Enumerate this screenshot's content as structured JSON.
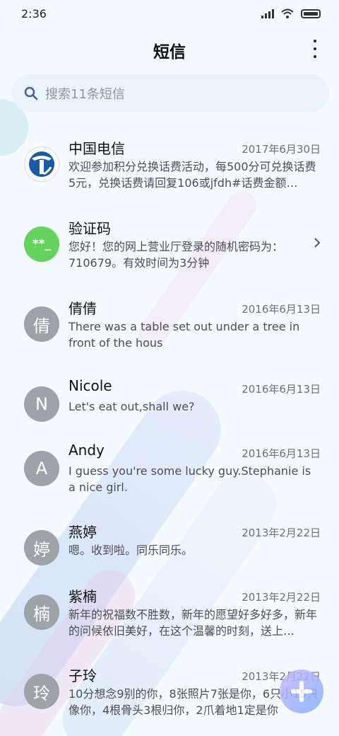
{
  "status_bar": {
    "time": "2:36"
  },
  "header": {
    "title": "短信"
  },
  "search": {
    "placeholder": "搜索11条短信"
  },
  "messages": [
    {
      "name": "中国电信",
      "date": "2017年6月30日",
      "preview": "欢迎参加积分兑换话费活动，每500分可兑换话费5元，兑换话费请回复106或jfdh#话费金额…",
      "avatar": "china-telecom-logo"
    },
    {
      "name": "验证码",
      "date": "",
      "preview": "您好！您的网上营业厅登录的随机密码为：710679。有效时间为3分钟",
      "avatar_text": "**_"
    },
    {
      "name": "倩倩",
      "date": "2016年6月13日",
      "preview": "There was a table set out under a tree in front of the hous",
      "avatar_text": "倩"
    },
    {
      "name": "Nicole",
      "date": "2016年6月13日",
      "preview": "Let's eat out,shall we?",
      "avatar_text": "N"
    },
    {
      "name": "Andy",
      "date": "2016年6月13日",
      "preview": "I guess you're some lucky guy.Stephanie is a nice girl.",
      "avatar_text": "A"
    },
    {
      "name": "燕婷",
      "date": "2013年2月22日",
      "preview": "嗯。收到啦。同乐同乐。",
      "avatar_text": "婷"
    },
    {
      "name": "紫楠",
      "date": "2013年2月22日",
      "preview": "新年的祝福数不胜数，新年的愿望好多好多，新年的问候依旧美好，在这个温馨的时刻，送上…",
      "avatar_text": "楠"
    },
    {
      "name": "子玲",
      "date": "2013年2月22日",
      "preview": "10分想念9别的你，8张照片7张是你，6只小15只像你，4根骨头3根归你，2爪着地1定是你",
      "avatar_text": "玲"
    }
  ],
  "colors": {
    "accent": "#63d35b",
    "avatar_grey": "#9ea3a8",
    "telecom_blue": "#1a5aa8"
  }
}
